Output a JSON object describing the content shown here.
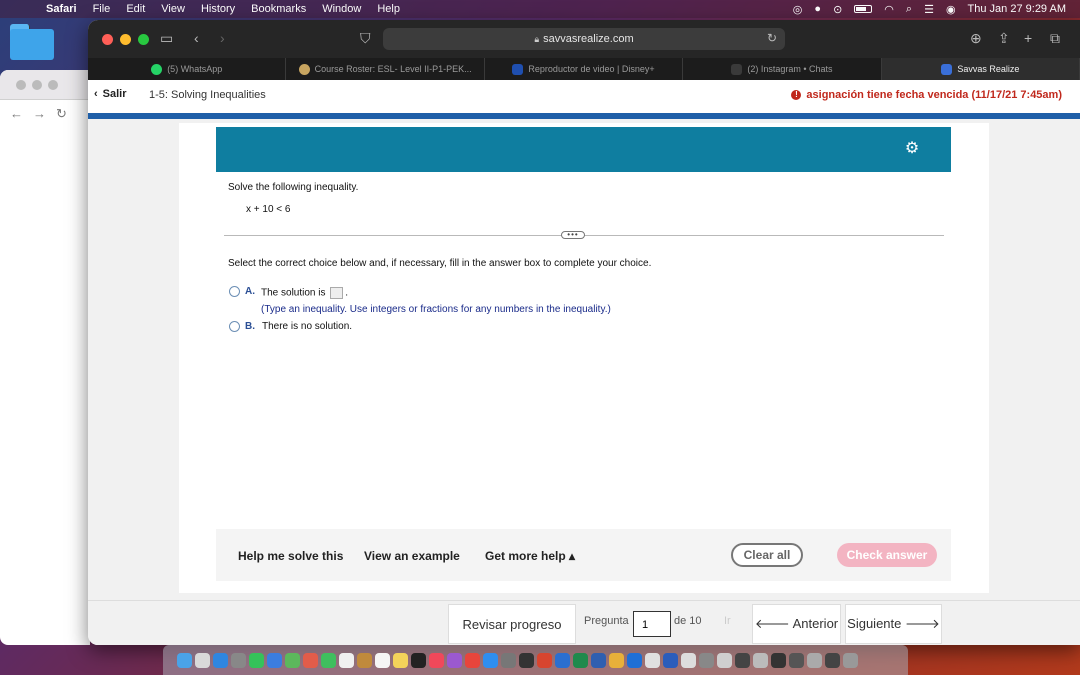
{
  "menubar": {
    "app": "Safari",
    "items": [
      "File",
      "Edit",
      "View",
      "History",
      "Bookmarks",
      "Window",
      "Help"
    ],
    "datetime": "Thu Jan 27  9:29 AM"
  },
  "browser": {
    "url": "savvasrealize.com",
    "tabs": [
      {
        "label": "(5) WhatsApp",
        "color": "#25d366"
      },
      {
        "label": "Course Roster: ESL- Level II-P1-PEK...",
        "color": "#c8a560"
      },
      {
        "label": "Reproductor de video | Disney+",
        "color": "#1f4fb0"
      },
      {
        "label": "(2) Instagram • Chats",
        "color": "#3a3a3a"
      },
      {
        "label": "Savvas Realize",
        "color": "#3a6fd8"
      }
    ]
  },
  "page": {
    "back_label": "Salir",
    "title": "1-5: Solving Inequalities",
    "overdue": "asignación tiene fecha vencida (11/17/21 7:45am)"
  },
  "question": {
    "prompt": "Solve the following inequality.",
    "expression": "x + 10 < 6",
    "instruction": "Select the correct choice below and, if necessary, fill in the answer box to complete your choice.",
    "choices": [
      {
        "letter": "A.",
        "text_before": "The solution is",
        "text_after": ".",
        "hint": "(Type an inequality. Use integers or fractions for any numbers in the inequality.)"
      },
      {
        "letter": "B.",
        "text": "There is no solution."
      }
    ]
  },
  "help": {
    "help_me": "Help me solve this",
    "example": "View an example",
    "more_help": "Get more help ▴",
    "clear": "Clear all",
    "check": "Check answer"
  },
  "nav": {
    "review": "Revisar progreso",
    "question_label": "Pregunta",
    "question_number": "1",
    "of_label": "de 10",
    "go": "Ir",
    "prev": "🡐 Anterior",
    "next": "Siguiente 🡒"
  }
}
